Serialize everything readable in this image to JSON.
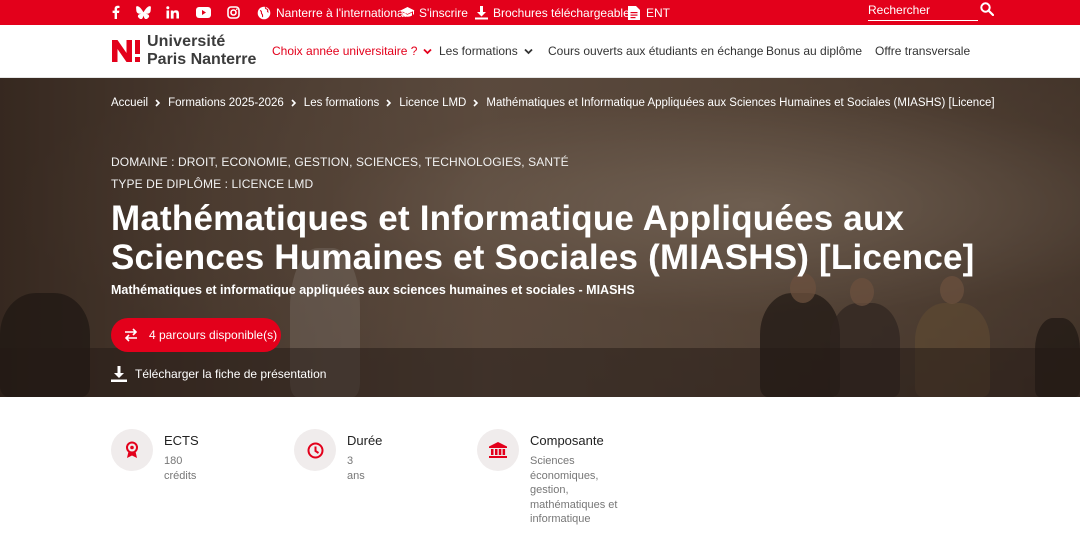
{
  "topbar": {
    "social_icons": [
      "facebook-icon",
      "bluesky-icon",
      "linkedin-icon",
      "youtube-icon",
      "instagram-icon"
    ],
    "links": [
      {
        "icon": "globe-icon",
        "label": "Nanterre à l'international"
      },
      {
        "icon": "graduation-cap-icon",
        "label": "S'inscrire"
      },
      {
        "icon": "download-icon",
        "label": "Brochures téléchargeables"
      },
      {
        "icon": "document-icon",
        "label": "ENT"
      }
    ],
    "search_placeholder": "Rechercher"
  },
  "logo": {
    "line1": "Université",
    "line2": "Paris Nanterre"
  },
  "nav": {
    "items": [
      {
        "label": "Choix année universitaire ?",
        "has_chevron": true,
        "active": true
      },
      {
        "label": "Les formations",
        "has_chevron": true,
        "active": false
      },
      {
        "label": "Cours ouverts aux étudiants en échange",
        "has_chevron": false,
        "active": false
      },
      {
        "label": "Bonus au diplôme",
        "has_chevron": false,
        "active": false
      },
      {
        "label": "Offre transversale",
        "has_chevron": false,
        "active": false
      }
    ]
  },
  "breadcrumb": [
    "Accueil",
    "Formations 2025-2026",
    "Les formations",
    "Licence LMD",
    "Mathématiques et Informatique Appliquées aux Sciences Humaines et Sociales (MIASHS) [Licence]"
  ],
  "hero": {
    "domaine": "DOMAINE : DROIT, ECONOMIE, GESTION, SCIENCES, TECHNOLOGIES, SANTÉ",
    "diplome": "TYPE DE DIPLÔME : LICENCE LMD",
    "title": "Mathématiques et Informatique Appliquées aux Sciences Humaines et Sociales (MIASHS) [Licence]",
    "subtitle": "Mathématiques et informatique appliquées aux sciences humaines et sociales - MIASHS",
    "parcours_button": "4 parcours disponible(s)",
    "download_link": "Télécharger la fiche de présentation"
  },
  "info": [
    {
      "icon": "award-icon",
      "label": "ECTS",
      "value": "180 crédits"
    },
    {
      "icon": "clock-icon",
      "label": "Durée",
      "value": "3 ans"
    },
    {
      "icon": "institution-icon",
      "label": "Composante",
      "value": "Sciences économiques, gestion, mathématiques et informatique"
    }
  ],
  "colors": {
    "brand_red": "#e3001b",
    "text_dark": "#333333",
    "text_muted": "#777777"
  }
}
